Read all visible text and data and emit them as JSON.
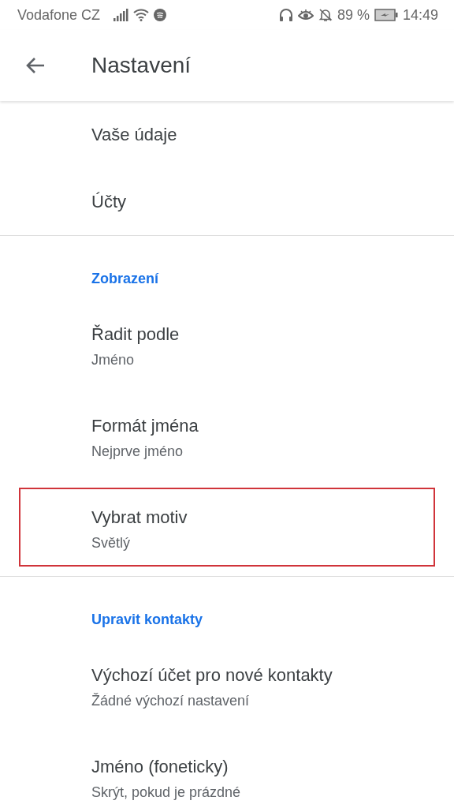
{
  "status_bar": {
    "carrier": "Vodafone CZ",
    "battery": "89 %",
    "time": "14:49"
  },
  "app_bar": {
    "title": "Nastavení"
  },
  "sections": [
    {
      "items": [
        {
          "title": "Vaše údaje",
          "highlighted": false
        },
        {
          "title": "Účty",
          "highlighted": false
        }
      ]
    },
    {
      "header": "Zobrazení",
      "items": [
        {
          "title": "Řadit podle",
          "subtitle": "Jméno",
          "highlighted": false
        },
        {
          "title": "Formát jména",
          "subtitle": "Nejprve jméno",
          "highlighted": false
        },
        {
          "title": "Vybrat motiv",
          "subtitle": "Světlý",
          "highlighted": true
        }
      ]
    },
    {
      "header": "Upravit kontakty",
      "items": [
        {
          "title": "Výchozí účet pro nové kontakty",
          "subtitle": "Žádné výchozí nastavení",
          "highlighted": false
        },
        {
          "title": "Jméno (foneticky)",
          "subtitle": "Skrýt, pokud je prázdné",
          "highlighted": false
        }
      ]
    }
  ]
}
